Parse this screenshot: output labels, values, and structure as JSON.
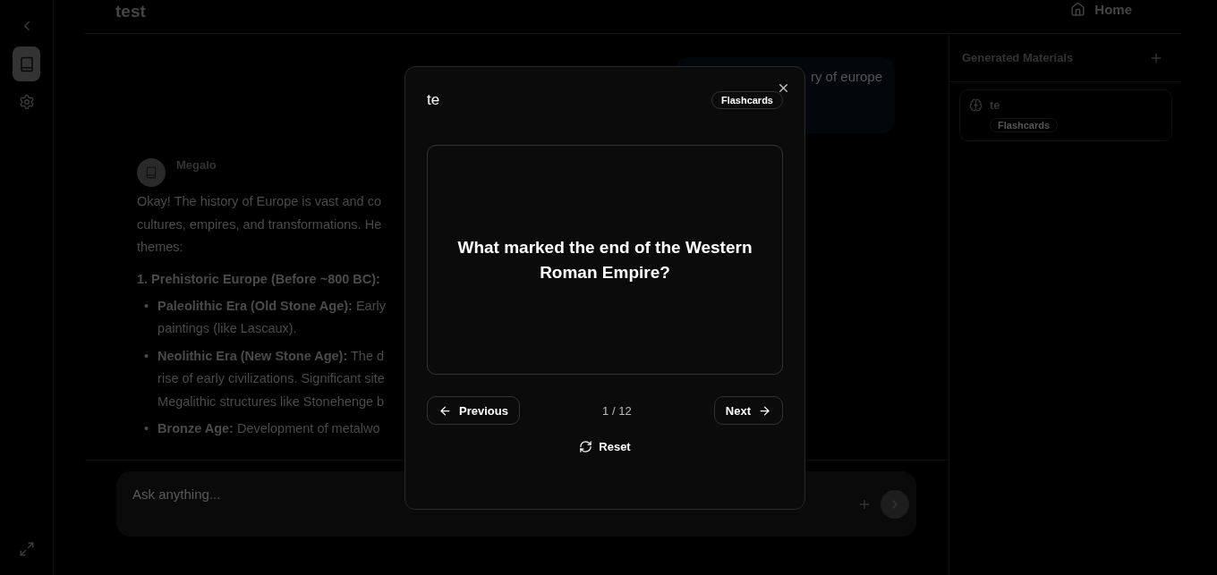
{
  "header": {
    "title": "test",
    "home": "Home"
  },
  "user_message": {
    "text": "ry of europe"
  },
  "assistant": {
    "name": "Megalo",
    "paragraph": "Okay! The history of Europe is vast and co\ncultures, empires, and transformations. He\nthemes:",
    "heading": "1. Prehistoric Europe (Before ~800 BC):",
    "bullets": [
      {
        "marker": "•",
        "term": "Paleolithic Era (Old Stone Age):",
        "text": " Early\npaintings (like Lascaux)."
      },
      {
        "marker": "•",
        "term": "Neolithic Era (New Stone Age):",
        "text": " The d\nrise of early civilizations. Significant site\nMegalithic structures like Stonehenge b"
      },
      {
        "marker": "•",
        "term": "Bronze Age:",
        "text": " Development of metalwo"
      }
    ]
  },
  "composer": {
    "placeholder": "Ask anything..."
  },
  "materials": {
    "title": "Generated Materials",
    "items": [
      {
        "name": "te",
        "type": "Flashcards"
      }
    ]
  },
  "modal": {
    "title": "te",
    "badge": "Flashcards",
    "question": "What marked the end of the Western Roman Empire?",
    "counter": "1 / 12",
    "previous": "Previous",
    "next": "Next",
    "reset": "Reset"
  }
}
